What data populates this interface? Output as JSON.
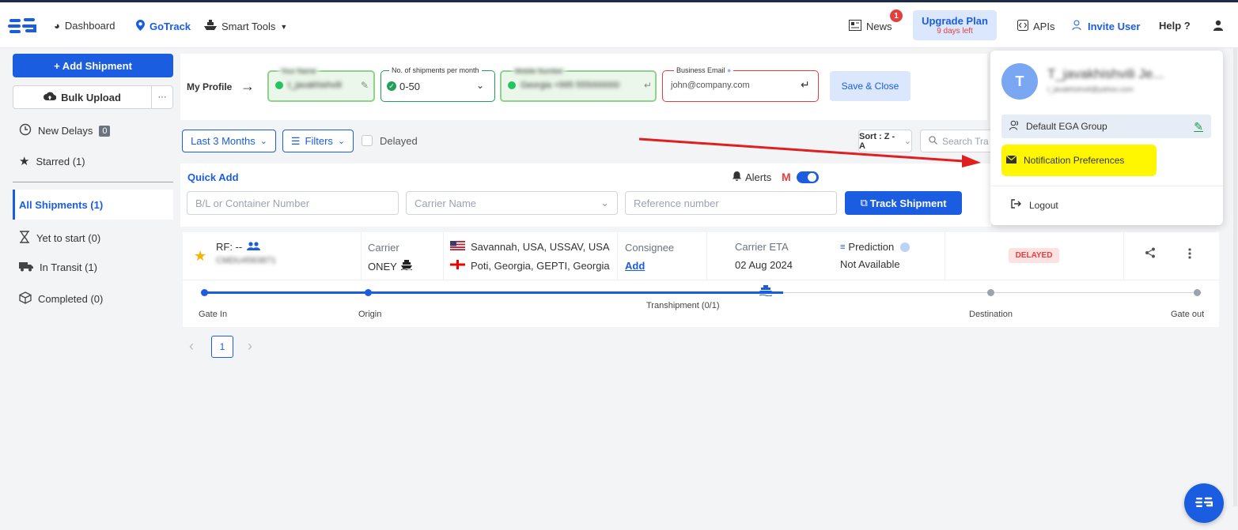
{
  "nav": {
    "dashboard": "Dashboard",
    "gotrack": "GoTrack",
    "smart_tools": "Smart Tools",
    "news": "News",
    "news_badge": "1",
    "upgrade_title": "Upgrade Plan",
    "upgrade_sub": "9 days left",
    "apis": "APIs",
    "invite_user": "Invite User",
    "help": "Help ?"
  },
  "sidebar": {
    "add_shipment": "+ Add Shipment",
    "bulk_upload": "Bulk Upload",
    "more": "···",
    "new_delays": "New Delays",
    "new_delays_count": "0",
    "starred": "Starred (1)",
    "all_shipments": "All Shipments (1)",
    "yet_to_start": "Yet to start (0)",
    "in_transit": "In Transit (1)",
    "completed": "Completed (0)"
  },
  "profile_bar": {
    "label": "My Profile",
    "arrow": "→",
    "field1_label": "Your Name",
    "field1_value": "t_javakhishvili",
    "shipments_label": "No. of shipments per month",
    "shipments_value": "0-50",
    "field3_label": "Mobile Number",
    "field3_value": "Georgia +995 555000000",
    "email_label": "Business Email",
    "email_placeholder": "john@company.com",
    "save_close": "Save & Close"
  },
  "filters": {
    "period": "Last 3 Months",
    "filters": "Filters",
    "delayed": "Delayed",
    "sort": "Sort : Z - A",
    "search_placeholder": "Search Tra"
  },
  "quick_add": {
    "title": "Quick Add",
    "alerts": "Alerts",
    "bl_placeholder": "B/L or Container Number",
    "carrier_placeholder": "Carrier Name",
    "reference_placeholder": "Reference number",
    "track_button": "Track Shipment"
  },
  "shipment": {
    "ref": "RF: --",
    "ref_id": "CMDU4563871",
    "carrier_label": "Carrier",
    "carrier_value": "ONEY",
    "origin": "Savannah, USA, USSAV, USA",
    "destination": "Poti, Georgia, GEPTI, Georgia",
    "consignee_label": "Consignee",
    "consignee_add": "Add",
    "eta_label": "Carrier ETA",
    "eta_value": "02 Aug 2024",
    "prediction_label": "Prediction",
    "prediction_value": "Not Available",
    "status": "DELAYED",
    "timeline": {
      "gate_in": "Gate In",
      "origin": "Origin",
      "transhipment": "Transhipment (0/1)",
      "destination": "Destination",
      "gate_out": "Gate out"
    },
    "progress": 0.58
  },
  "pagination": {
    "prev": "‹",
    "page": "1",
    "next": "›"
  },
  "popup": {
    "avatar_letter": "T",
    "user_name": "T_javakhishvili Je...",
    "user_email": "t_javakhishvili@yahoo.com",
    "group": "Default EGA Group",
    "notification_prefs": "Notification Preferences",
    "logout": "Logout"
  },
  "colors": {
    "primary": "#1a5de0",
    "highlight": "#fff700",
    "annotation_arrow": "#e02020",
    "delayed_bg": "#fde2e2",
    "delayed_text": "#e53e3e"
  }
}
